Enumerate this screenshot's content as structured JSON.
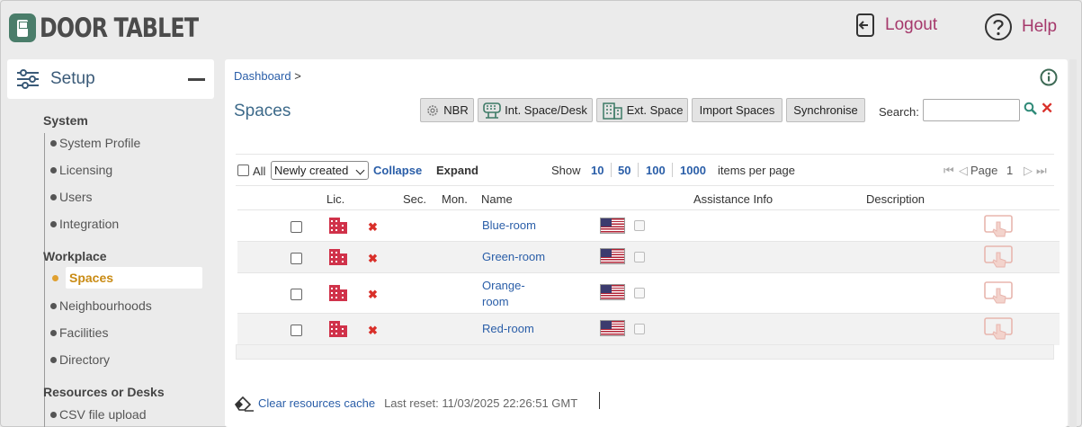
{
  "app": {
    "logo_text": "DOOR TABLET",
    "logout_label": "Logout",
    "help_label": "Help"
  },
  "nav": {
    "title": "Setup",
    "groups": [
      {
        "label": "System",
        "items": [
          "System Profile",
          "Licensing",
          "Users",
          "Integration"
        ]
      },
      {
        "label": "Workplace",
        "items": [
          "Spaces",
          "Neighbourhoods",
          "Facilities",
          "Directory"
        ]
      },
      {
        "label": "Resources or Desks",
        "items": [
          "CSV file upload"
        ]
      }
    ],
    "active_item": "Spaces"
  },
  "breadcrumb": {
    "link": "Dashboard",
    "sep": ">"
  },
  "page_title": "Spaces",
  "toolbar": {
    "nbr": "NBR",
    "int_space": "Int. Space/Desk",
    "ext_space": "Ext. Space",
    "import": "Import Spaces",
    "sync": "Synchronise",
    "search_label": "Search:",
    "search_value": ""
  },
  "listbar": {
    "all_label": "All",
    "sort_value": "Newly created",
    "collapse": "Collapse",
    "expand": "Expand",
    "show_label": "Show",
    "page_sizes": [
      "10",
      "50",
      "100",
      "1000"
    ],
    "per_page": "items per page",
    "page_label": "Page",
    "page_number": "1"
  },
  "table": {
    "headers": {
      "lic": "Lic.",
      "sec": "Sec.",
      "mon": "Mon.",
      "name": "Name",
      "assist": "Assistance Info",
      "desc": "Description"
    },
    "rows": [
      {
        "name": "Blue-room"
      },
      {
        "name": "Green-room"
      },
      {
        "name": "Orange-room",
        "line1": "Orange-",
        "line2": "room"
      },
      {
        "name": "Red-room"
      }
    ]
  },
  "footer": {
    "clear_cache": "Clear resources cache",
    "last_reset": "Last reset: 11/03/2025 22:26:51 GMT"
  },
  "colors": {
    "accent_link": "#2a5ea8",
    "logout_help": "#a5386b",
    "active_nav": "#c98b14",
    "brand_green": "#4a7d6a",
    "lic_icon": "#d0324a"
  },
  "icons": [
    "logout-icon",
    "help-icon",
    "setup-sliders-icon",
    "info-icon",
    "gear-icon",
    "int-space-icon",
    "ext-space-icon",
    "search-icon",
    "clear-icon",
    "building-icon",
    "delete-x-icon",
    "us-flag-icon",
    "touch-panel-icon",
    "eraser-icon"
  ]
}
